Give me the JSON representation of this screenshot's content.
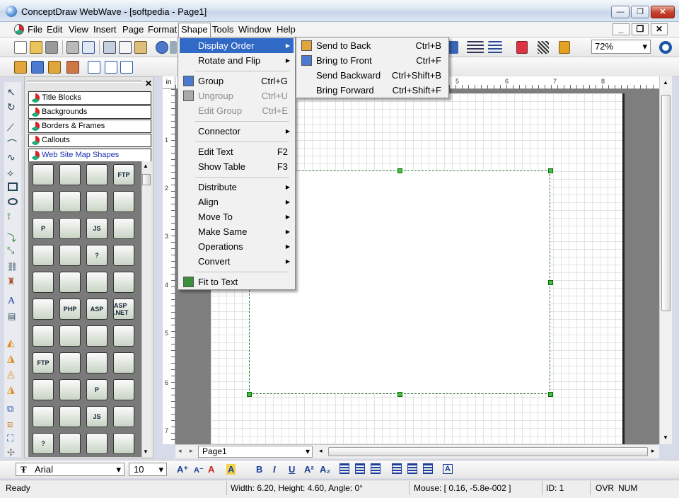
{
  "window": {
    "title": "ConceptDraw WebWave - [softpedia - Page1]",
    "minimize": "—",
    "restore": "❐",
    "close": "✕"
  },
  "menubar": {
    "items": [
      "File",
      "Edit",
      "View",
      "Insert",
      "Page",
      "Format",
      "Shape",
      "Tools",
      "Window",
      "Help"
    ],
    "active": "Shape",
    "mdi": [
      "_",
      "❐",
      "✕"
    ]
  },
  "toolbar": {
    "zoom": "72%"
  },
  "library": {
    "tabs": [
      "Title Blocks",
      "Backgrounds",
      "Borders & Frames",
      "Callouts",
      "Web Site Map Shapes"
    ],
    "active_tab": "Web Site Map Shapes",
    "shape_labels": [
      "",
      "",
      "",
      "FTP",
      "",
      "",
      "",
      "",
      "P",
      "",
      "JS",
      "",
      "",
      "",
      "?",
      "",
      "",
      "",
      "",
      "",
      "",
      "PHP",
      "ASP",
      "ASP .NET",
      "",
      "",
      "",
      "",
      "FTP",
      "",
      "",
      "",
      "",
      "",
      "P",
      "",
      "",
      "",
      "JS",
      "",
      "?",
      "",
      "",
      ""
    ]
  },
  "ruler": {
    "unit": "in",
    "top_ticks": [
      "5",
      "6",
      "7",
      "8"
    ],
    "left_ticks": [
      "1",
      "2",
      "3",
      "4",
      "5",
      "6",
      "7"
    ]
  },
  "page_tab": "Page1",
  "shape_menu": {
    "items": [
      {
        "label": "Display Order",
        "submenu": true,
        "highlight": true
      },
      {
        "label": "Rotate and Flip",
        "submenu": true
      },
      {
        "sep": true
      },
      {
        "label": "Group",
        "shortcut": "Ctrl+G",
        "icon": "group-icon"
      },
      {
        "label": "Ungroup",
        "shortcut": "Ctrl+U",
        "disabled": true,
        "icon": "ungroup-icon"
      },
      {
        "label": "Edit Group",
        "shortcut": "Ctrl+E",
        "disabled": true
      },
      {
        "sep": true
      },
      {
        "label": "Connector",
        "submenu": true
      },
      {
        "sep": true
      },
      {
        "label": "Edit Text",
        "shortcut": "F2"
      },
      {
        "label": "Show Table",
        "shortcut": "F3"
      },
      {
        "sep": true
      },
      {
        "label": "Distribute",
        "submenu": true
      },
      {
        "label": "Align",
        "submenu": true
      },
      {
        "label": "Move To",
        "submenu": true
      },
      {
        "label": "Make Same",
        "submenu": true
      },
      {
        "label": "Operations",
        "submenu": true
      },
      {
        "label": "Convert",
        "submenu": true
      },
      {
        "sep": true
      },
      {
        "label": "Fit to Text",
        "icon": "fit-text-icon"
      }
    ]
  },
  "order_menu": {
    "items": [
      {
        "label": "Send to Back",
        "shortcut": "Ctrl+B",
        "icon": "send-back-icon"
      },
      {
        "label": "Bring to Front",
        "shortcut": "Ctrl+F",
        "icon": "bring-front-icon"
      },
      {
        "label": "Send Backward",
        "shortcut": "Ctrl+Shift+B"
      },
      {
        "label": "Bring Forward",
        "shortcut": "Ctrl+Shift+F"
      }
    ]
  },
  "format": {
    "font": "Arial",
    "size": "10"
  },
  "status": {
    "ready": "Ready",
    "dimensions": "Width: 6.20,  Height: 4.60,  Angle: 0°",
    "mouse": "Mouse: [ 0.16, -5.8e-002 ]",
    "id": "ID: 1",
    "ovr": "OVR",
    "num": "NUM"
  },
  "colors": {
    "highlight": "#3169c6",
    "selection": "#3ac43a"
  }
}
